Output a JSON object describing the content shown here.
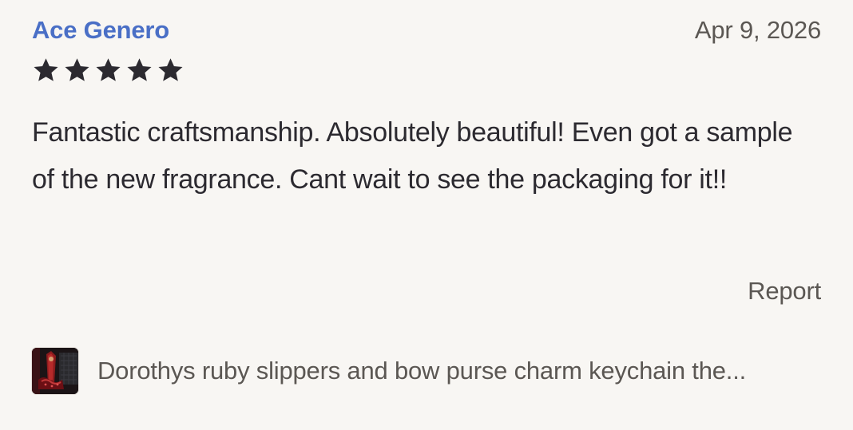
{
  "review": {
    "reviewer_name": "Ace Genero",
    "date": "Apr 9, 2026",
    "rating": 5,
    "rating_max": 5,
    "star_color": "#2c2a30",
    "text": "Fantastic craftsmanship. Absolutely beautiful! Even got a sample of the new fragrance. Cant wait to see the packaging for it!!",
    "report_label": "Report"
  },
  "product": {
    "title": "Dorothys ruby slippers and bow purse charm keychain the...",
    "thumbnail_icon": "product-thumbnail-image"
  },
  "colors": {
    "background": "#f8f6f3",
    "link": "#4a6fc6",
    "muted_text": "#5b5753",
    "body_text": "#2c2a30"
  }
}
